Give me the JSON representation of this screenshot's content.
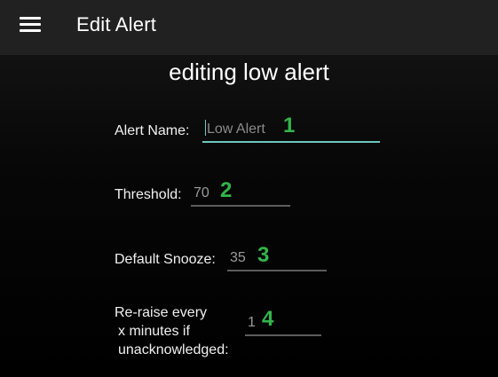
{
  "appbar": {
    "menu_icon": "hamburger-menu-icon",
    "title": "Edit Alert"
  },
  "heading": "editing low alert",
  "form": {
    "alert_name": {
      "label": "Alert Name:",
      "value": "Low Alert",
      "badge": "1"
    },
    "threshold": {
      "label": "Threshold:",
      "value": "70",
      "badge": "2"
    },
    "default_snooze": {
      "label": "Default Snooze:",
      "value": "35",
      "badge": "3"
    },
    "reraise": {
      "label_line1": "Re-raise every",
      "label_line2": "x minutes if",
      "label_line3": "unacknowledged:",
      "value": "1",
      "badge": "4"
    }
  },
  "colors": {
    "appbar": "#212121",
    "background": "#000000",
    "focus_underline": "#6cc8bf",
    "badge": "#33b54a"
  }
}
